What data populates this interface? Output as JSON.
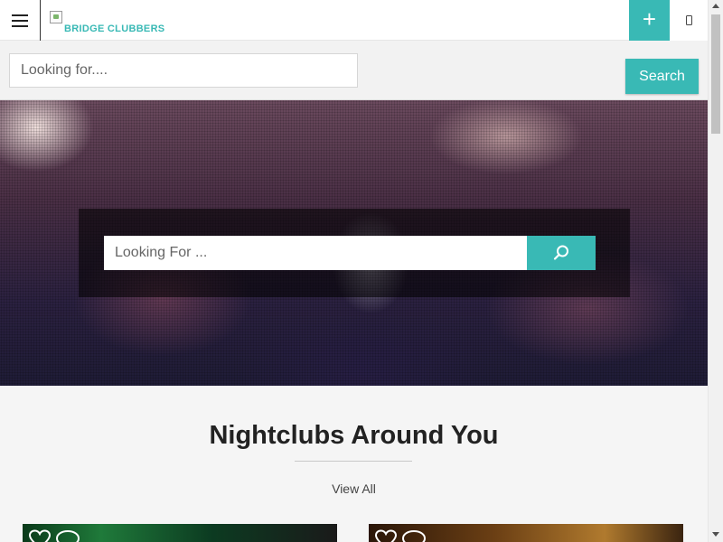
{
  "header": {
    "logo_alt": "BRIDGE CLUBBERS",
    "menu_icon": "hamburger-icon",
    "add_icon": "plus-icon",
    "add_symbol": "+",
    "phone_icon": "mobile-phone-icon"
  },
  "search_strip": {
    "placeholder": "Looking for....",
    "button_label": "Search"
  },
  "hero": {
    "placeholder": "Looking For ...",
    "button_icon": "search-icon"
  },
  "section": {
    "title": "Nightclubs Around You",
    "view_all": "View All"
  },
  "cards": [
    {
      "icons": [
        "heart-icon",
        "chat-bubble-icon"
      ]
    },
    {
      "icons": [
        "heart-icon",
        "chat-bubble-icon"
      ]
    }
  ],
  "colors": {
    "accent": "#39b9b5",
    "background": "#f5f5f5",
    "text": "#222222"
  }
}
